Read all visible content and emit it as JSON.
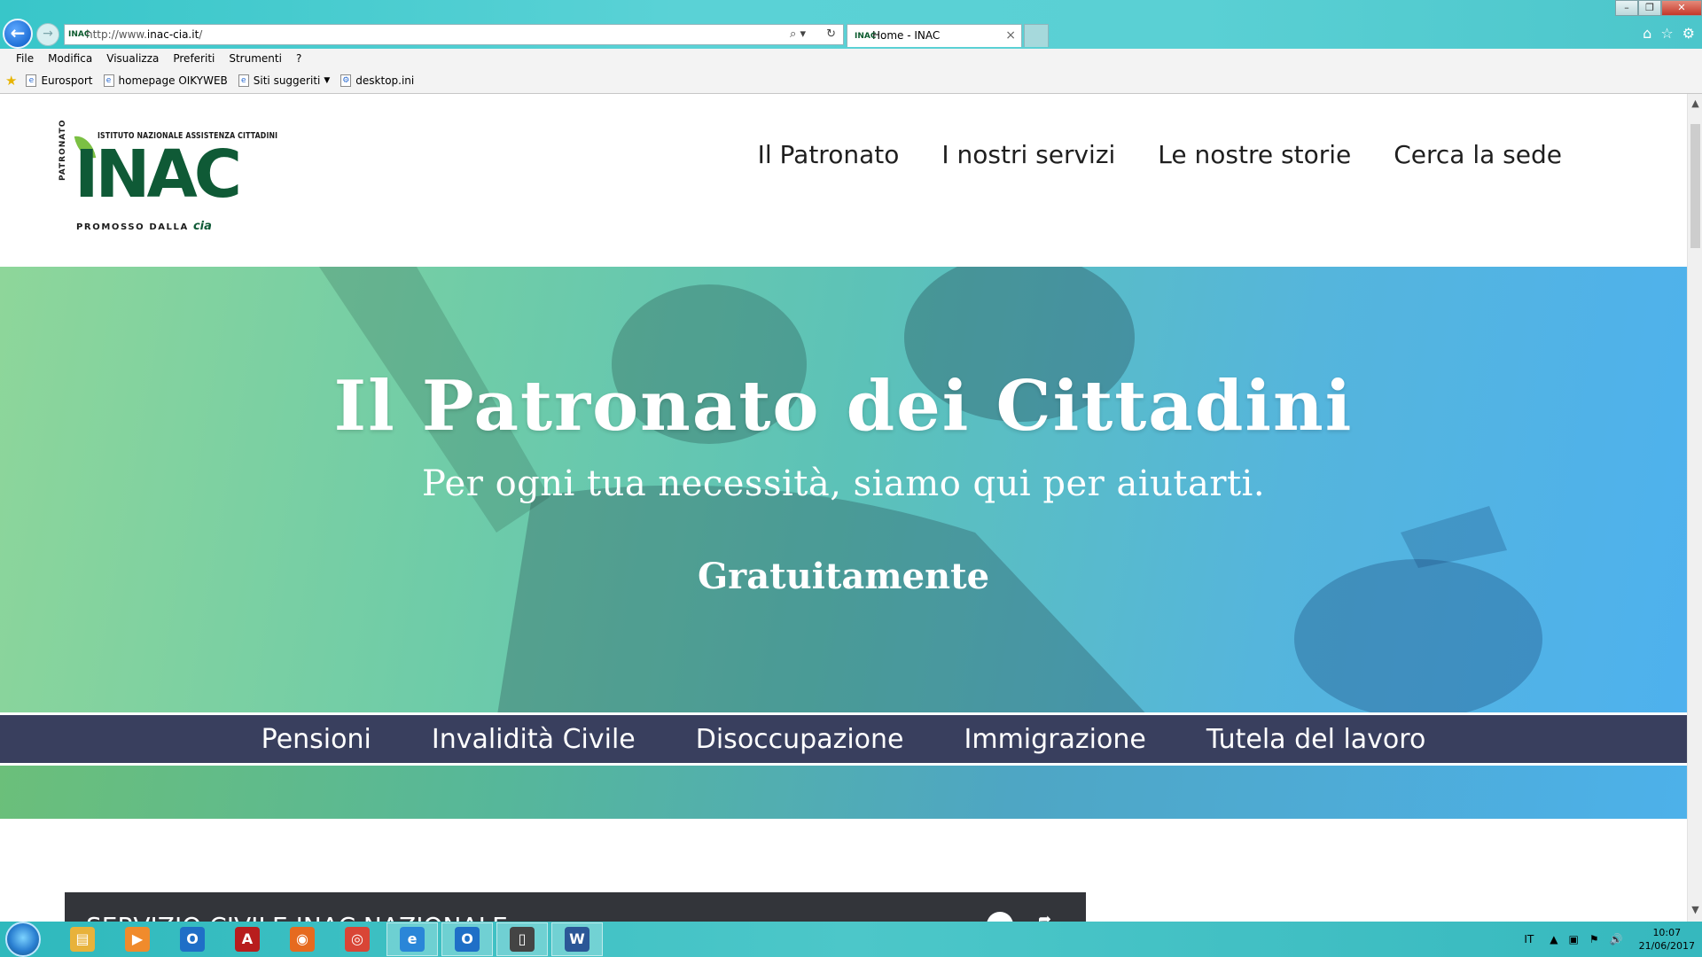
{
  "browser": {
    "url_prefix": "http://www.",
    "url_domain": "inac-cia.it",
    "url_suffix": "/",
    "tab_title": "Home - INAC",
    "favicon_text": "INAC",
    "menu": [
      "File",
      "Modifica",
      "Visualizza",
      "Preferiti",
      "Strumenti",
      "?"
    ],
    "favorites": [
      {
        "label": "Eurosport",
        "has_dropdown": false
      },
      {
        "label": "homepage OIKYWEB",
        "has_dropdown": false
      },
      {
        "label": "Siti suggeriti",
        "has_dropdown": true
      },
      {
        "label": "desktop.ini",
        "has_dropdown": false
      }
    ]
  },
  "logo": {
    "top_text": "ISTITUTO NAZIONALE ASSISTENZA CITTADINI",
    "side_text": "PATRONATO",
    "main_text": "INAC",
    "bottom_text": "PROMOSSO DALLA",
    "bottom_mark": "cia",
    "brand_green": "#0f5a36",
    "leaf_green": "#7bc043"
  },
  "nav": {
    "items": [
      "Il Patronato",
      "I nostri servizi",
      "Le nostre storie",
      "Cerca la sede"
    ]
  },
  "hero": {
    "title": "Il Patronato dei Cittadini",
    "subtitle": "Per ogni tua necessità, siamo qui per aiutarti.",
    "cta": "Gratuitamente"
  },
  "services": {
    "items": [
      "Pensioni",
      "Invalidità Civile",
      "Disoccupazione",
      "Immigrazione",
      "Tutela del lavoro"
    ],
    "bar_color": "#393f5e"
  },
  "video": {
    "title": "SERVIZIO CIVILE INAC NAZIONALE"
  },
  "taskbar": {
    "apps": [
      {
        "name": "file-explorer",
        "glyph": "▤",
        "color": "#e8b23a",
        "active": false
      },
      {
        "name": "media-player",
        "glyph": "▶",
        "color": "#f08b2c",
        "active": false
      },
      {
        "name": "outlook",
        "glyph": "O",
        "color": "#1f6fc7",
        "active": false
      },
      {
        "name": "acrobat",
        "glyph": "A",
        "color": "#b81d1d",
        "active": false
      },
      {
        "name": "firefox",
        "glyph": "◉",
        "color": "#e66a1f",
        "active": false
      },
      {
        "name": "chrome",
        "glyph": "◎",
        "color": "#d94536",
        "active": false
      },
      {
        "name": "internet-explorer",
        "glyph": "e",
        "color": "#2a86d8",
        "active": true
      },
      {
        "name": "outlook-2",
        "glyph": "O",
        "color": "#1f6fc7",
        "active": true
      },
      {
        "name": "phone-app",
        "glyph": "▯",
        "color": "#444444",
        "active": true
      },
      {
        "name": "word",
        "glyph": "W",
        "color": "#2b5797",
        "active": true
      }
    ],
    "language": "IT",
    "time": "10:07",
    "date": "21/06/2017"
  }
}
